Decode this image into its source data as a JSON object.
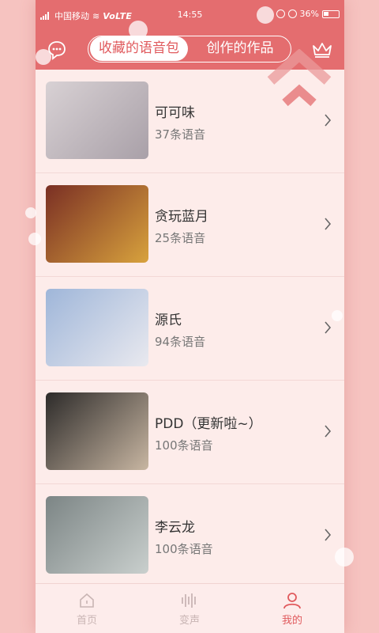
{
  "status_bar": {
    "carrier": "中国移动",
    "network": "VoLTE",
    "time": "14:55",
    "battery": "36%"
  },
  "header": {
    "tabs": [
      {
        "label": "收藏的语音包",
        "active": true
      },
      {
        "label": "创作的作品",
        "active": false
      }
    ],
    "left_icon": "chat-bubble-icon",
    "right_icon": "crown-icon"
  },
  "voice_packs": [
    {
      "title": "可可味",
      "subtitle": "37条语音",
      "thumb_colors": [
        "#d8d1d4",
        "#a9a0a8"
      ]
    },
    {
      "title": "贪玩蓝月",
      "subtitle": "25条语音",
      "thumb_colors": [
        "#7a2f24",
        "#d8a23d"
      ]
    },
    {
      "title": "源氏",
      "subtitle": "94条语音",
      "thumb_colors": [
        "#9fb6d9",
        "#e9e9ef"
      ]
    },
    {
      "title": "PDD（更新啦~）",
      "subtitle": "100条语音",
      "thumb_colors": [
        "#2d2b2a",
        "#c8b6a2"
      ]
    },
    {
      "title": "李云龙",
      "subtitle": "100条语音",
      "thumb_colors": [
        "#7c8585",
        "#c9cfcd"
      ]
    }
  ],
  "bottom_nav": [
    {
      "label": "首页",
      "icon": "home-icon",
      "active": false
    },
    {
      "label": "变声",
      "icon": "soundwave-icon",
      "active": false
    },
    {
      "label": "我的",
      "icon": "profile-icon",
      "active": true
    }
  ],
  "colors": {
    "accent": "#e46d6f",
    "active_text": "#e05a5d",
    "background": "#fdecea"
  }
}
